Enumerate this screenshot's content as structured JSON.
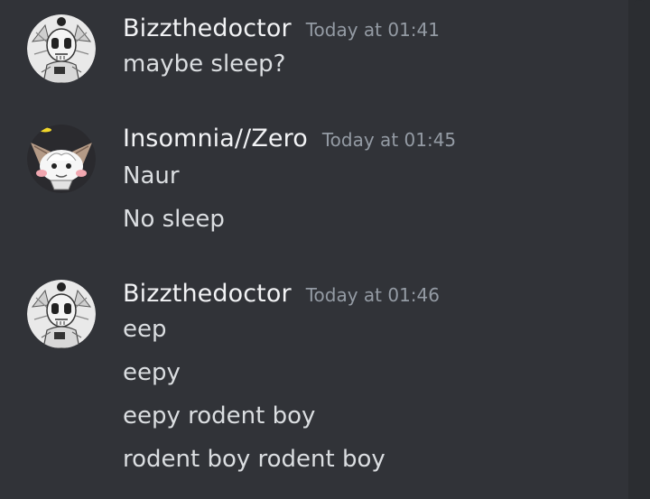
{
  "messages": [
    {
      "username": "Bizzthedoctor",
      "timestamp": "Today at 01:41",
      "lines": [
        "maybe sleep?"
      ]
    },
    {
      "username": "Insomnia//Zero",
      "timestamp": "Today at 01:45",
      "lines": [
        "Naur",
        "No sleep"
      ]
    },
    {
      "username": "Bizzthedoctor",
      "timestamp": "Today at 01:46",
      "lines": [
        "eep",
        "eepy",
        "eepy rodent boy",
        "rodent boy rodent boy"
      ]
    }
  ],
  "colors": {
    "background": "#313338",
    "username": "#f2f3f5",
    "timestamp": "#949ba4",
    "message_text": "#dbdee1"
  }
}
